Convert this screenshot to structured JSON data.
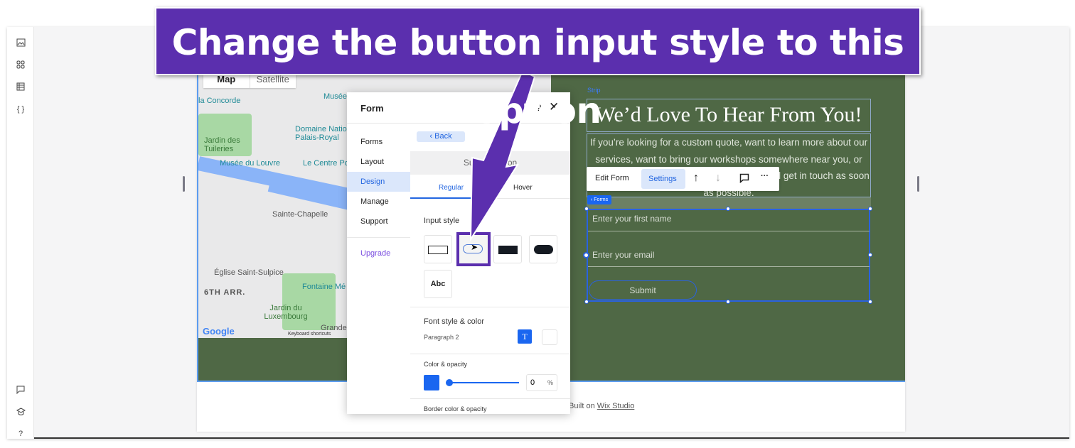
{
  "banner": {
    "text": "Change the button input style to this option",
    "color": "#5b2fae"
  },
  "left_toolbar": {
    "top_icons": [
      "image-icon",
      "apps-grid-icon",
      "table-icon",
      "code-braces-icon"
    ],
    "bottom_icons": [
      "chat-icon",
      "graduation-cap-icon",
      "help-icon"
    ],
    "code_glyph": "{ }",
    "help_glyph": "?"
  },
  "map": {
    "tabs": [
      "Map",
      "Satellite"
    ],
    "labels": [
      "la Concorde",
      "Musée",
      "Domaine National du Palais-Royal",
      "Jardin des Tuileries",
      "Musée du Louvre",
      "Le Centre Po",
      "Sainte-Chapelle",
      "Église Saint-Sulpice",
      "6TH ARR.",
      "Fontaine Mé",
      "Jardin du Luxembourg",
      "Grande"
    ],
    "google": "Google",
    "shortcuts": "Keyboard shortcuts"
  },
  "footer": {
    "prefix": "Built on",
    "link": "Wix Studio"
  },
  "panel": {
    "title": "Form",
    "help": "?",
    "close": "✕",
    "nav": [
      "Forms",
      "Layout",
      "Design",
      "Manage",
      "Support"
    ],
    "active_nav": "Design",
    "upgrade": "Upgrade",
    "back": "Back",
    "section": "Submit Button",
    "tabs": [
      "Regular",
      "Hover"
    ],
    "active_tab": "Regular",
    "input_style_label": "Input style",
    "input_style_options": [
      "outline-rectangle",
      "outline-pill",
      "filled-rectangle",
      "filled-pill",
      "text-only"
    ],
    "text_only_label": "Abc",
    "highlighted_option": "outline-pill",
    "font_label": "Font style & color",
    "font_value": "Paragraph 2",
    "font_icon": "T",
    "color_label": "Color & opacity",
    "color_value": "#1a66f0",
    "opacity_value": "0",
    "opacity_unit": "%",
    "border_label": "Border color & opacity"
  },
  "site": {
    "strip_label": "Strip",
    "heading": "We’d Love To Hear From You!",
    "body": "If you’re looking for a custom quote, want to learn more about our services, want to bring our workshops somewhere near you, or just want to say hello — Contact us, and we’ll get in touch as soon as possible.",
    "forms_tag": "‹ Forms",
    "fields": [
      "Enter your first name",
      "Enter your email"
    ],
    "submit": "Submit",
    "background_color": "#4f6845"
  },
  "toolbar": {
    "edit_form": "Edit Form",
    "settings": "Settings",
    "up": "↑",
    "down": "↓",
    "more": "···"
  }
}
